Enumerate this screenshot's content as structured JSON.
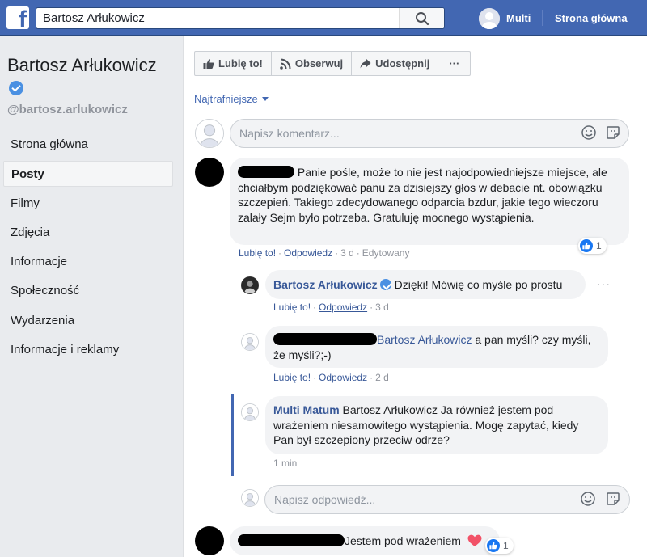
{
  "topbar": {
    "logo": "f",
    "search_value": "Bartosz Arłukowicz",
    "user_name": "Multi",
    "home_label": "Strona główna"
  },
  "sidebar": {
    "page_name": "Bartosz Arłukowicz",
    "handle": "@bartosz.arlukowicz",
    "items": [
      {
        "label": "Strona główna"
      },
      {
        "label": "Posty",
        "active": true
      },
      {
        "label": "Filmy"
      },
      {
        "label": "Zdjęcia"
      },
      {
        "label": "Informacje"
      },
      {
        "label": "Społeczność"
      },
      {
        "label": "Wydarzenia"
      },
      {
        "label": "Informacje i reklamy"
      }
    ]
  },
  "actions": {
    "like": "Lubię to!",
    "follow": "Obserwuj",
    "share": "Udostępnij",
    "more": "···"
  },
  "sort_label": "Najtrafniejsze",
  "comment_composer": {
    "placeholder": "Napisz komentarz..."
  },
  "reply_composer": {
    "placeholder": "Napisz odpowiedź..."
  },
  "comments": [
    {
      "text": "Panie pośle, może to nie jest najodpowiedniejsze miejsce, ale chciałbym podziękować panu za dzisiejszy głos w debacie nt. obowiązku szczepień. Takiego zdecydowanego odparcia bzdur, jakie tego wieczoru zalały Sejm było potrzeba. Gratuluję mocnego wystąpienia.",
      "like": "Lubię to!",
      "reply": "Odpowiedz",
      "time": "3 d",
      "edited": "Edytowany",
      "reactions": "1"
    },
    {
      "author": "Bartosz Arłukowicz",
      "text": "Dzięki! Mówię co myśle po prostu",
      "like": "Lubię to!",
      "reply": "Odpowiedz",
      "time": "3 d",
      "more": "···"
    },
    {
      "mention": "Bartosz Arłukowicz",
      "text": "a pan myśli? czy myśli, że myśli?;-)",
      "like": "Lubię to!",
      "reply": "Odpowiedz",
      "time": "2 d"
    },
    {
      "author": "Multi Matum",
      "text": "Bartosz Arłukowicz Ja również jestem pod wrażeniem niesamowitego wystąpienia. Mogę zapytać, kiedy Pan był szczepiony przeciw odrze?",
      "time": "1 min"
    },
    {
      "text": "Jestem pod wrażeniem",
      "reactions": "1"
    }
  ],
  "colors": {
    "brand": "#4267b2",
    "link": "#385898",
    "like_blue": "#1877f2",
    "heart": "#f25268"
  }
}
